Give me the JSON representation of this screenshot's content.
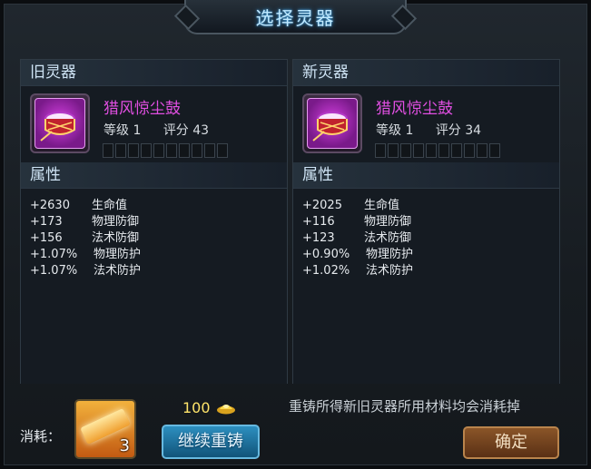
{
  "window": {
    "title": "选择灵器"
  },
  "panels": {
    "old": {
      "header": "旧灵器",
      "item_name": "猎风惊尘鼓",
      "level_text": "等级 1",
      "score_text": "评分 43",
      "attr_header": "属性",
      "attrs": [
        {
          "value": "+2630",
          "name": "生命值"
        },
        {
          "value": "+173",
          "name": "物理防御"
        },
        {
          "value": "+156",
          "name": "法术防御"
        },
        {
          "value": "+1.07%",
          "name": "物理防护"
        },
        {
          "value": "+1.07%",
          "name": "法术防护"
        }
      ]
    },
    "new": {
      "header": "新灵器",
      "item_name": "猎风惊尘鼓",
      "level_text": "等级 1",
      "score_text": "评分 34",
      "attr_header": "属性",
      "attrs": [
        {
          "value": "+2025",
          "name": "生命值"
        },
        {
          "value": "+116",
          "name": "物理防御"
        },
        {
          "value": "+123",
          "name": "法术防御"
        },
        {
          "value": "+0.90%",
          "name": "物理防护"
        },
        {
          "value": "+1.02%",
          "name": "法术防护"
        }
      ]
    }
  },
  "footer": {
    "cost_label": "消耗：",
    "material_count": "3",
    "gold_cost": "100",
    "continue_button": "继续重铸",
    "notice": "重铸所得新旧灵器所用材料均会消耗掉",
    "confirm_button": "确定"
  },
  "icons": {
    "item": "drum-icon",
    "material": "gold-bar-icon",
    "currency": "gold-ingot-icon"
  },
  "colors": {
    "item_name": "#e14fe2",
    "title": "#bfe9ff",
    "continue_button": "#1f78a8",
    "confirm_button": "#7a4a22",
    "gold_text": "#ffe46a"
  }
}
